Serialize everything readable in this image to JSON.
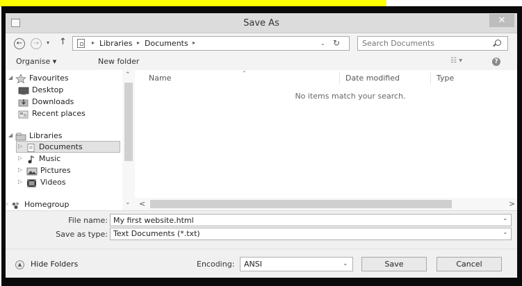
{
  "window": {
    "title": "Save As",
    "close_glyph": "✕"
  },
  "navigation": {
    "back_glyph": "←",
    "forward_glyph": "→",
    "recent_glyph": "▾",
    "up_glyph": "↑",
    "breadcrumbs": [
      "Libraries",
      "Documents"
    ],
    "crumb_separator": "▸",
    "address_dropdown_glyph": "⌄",
    "refresh_glyph": "↻",
    "search_placeholder": "Search Documents"
  },
  "toolbar": {
    "organise_label": "Organise ▾",
    "new_folder_label": "New folder",
    "view_options_glyph": "☷ ▾",
    "help_glyph": "?"
  },
  "sidebar": {
    "items": [
      {
        "label": "Favourites",
        "icon": "star-icon",
        "expander": "◢"
      },
      {
        "label": "Desktop",
        "icon": "desktop-icon"
      },
      {
        "label": "Downloads",
        "icon": "downloads-icon"
      },
      {
        "label": "Recent places",
        "icon": "recent-places-icon"
      },
      {
        "label": "Libraries",
        "icon": "libraries-icon",
        "expander": "◢"
      },
      {
        "label": "Documents",
        "icon": "documents-icon",
        "expander": "▷",
        "selected": true
      },
      {
        "label": "Music",
        "icon": "music-icon",
        "expander": "▷"
      },
      {
        "label": "Pictures",
        "icon": "pictures-icon",
        "expander": "▷"
      },
      {
        "label": "Videos",
        "icon": "videos-icon",
        "expander": "▷"
      },
      {
        "label": "Homegroup",
        "icon": "homegroup-icon",
        "expander": "▷"
      }
    ],
    "scroll_up_glyph": "⌃",
    "scroll_down_glyph": "⌄"
  },
  "file_list": {
    "columns": [
      "Name",
      "Date modified",
      "Type"
    ],
    "sort_glyph": "⌃",
    "empty_message": "No items match your search.",
    "scroll_left_glyph": "<",
    "scroll_right_glyph": ">"
  },
  "form": {
    "filename_label": "File name:",
    "filename_value": "My first website.html",
    "savetype_label": "Save as type:",
    "savetype_value": "Text Documents (*.txt)",
    "dropdown_glyph": "⌄",
    "hide_folders_label": "Hide Folders",
    "hide_folders_glyph": "▲",
    "encoding_label": "Encoding:",
    "encoding_value": "ANSI",
    "save_label": "Save",
    "cancel_label": "Cancel"
  },
  "colors": {
    "highlight_strip": "#ffff00",
    "frame": "#0a0a0a",
    "titlebar": "#dcdcdc",
    "selection": "#e2e2e2"
  }
}
